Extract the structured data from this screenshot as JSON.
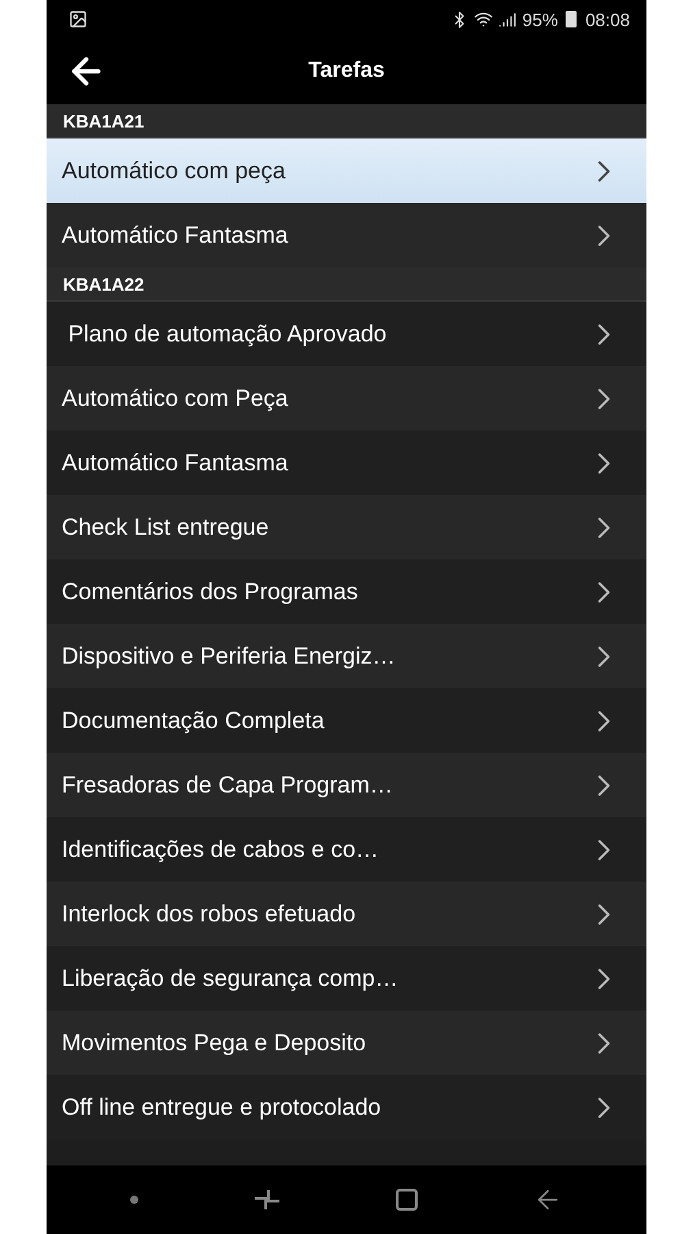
{
  "status_bar": {
    "battery": "95%",
    "time": "08:08"
  },
  "header": {
    "title": "Tarefas"
  },
  "sections": [
    {
      "title": "KBA1A21",
      "items": [
        {
          "label": "Automático com peça",
          "selected": true
        },
        {
          "label": "Automático Fantasma",
          "selected": false
        }
      ]
    },
    {
      "title": "KBA1A22",
      "items": [
        {
          "label": " Plano de automação Aprovado",
          "selected": false
        },
        {
          "label": "Automático com Peça",
          "selected": false
        },
        {
          "label": "Automático Fantasma",
          "selected": false
        },
        {
          "label": "Check List entregue",
          "selected": false
        },
        {
          "label": "Comentários dos Programas",
          "selected": false
        },
        {
          "label": "Dispositivo e Periferia Energiz…",
          "selected": false
        },
        {
          "label": "Documentação Completa",
          "selected": false
        },
        {
          "label": "Fresadoras de Capa Program…",
          "selected": false
        },
        {
          "label": "Identificações de cabos e co…",
          "selected": false
        },
        {
          "label": "Interlock dos robos efetuado",
          "selected": false
        },
        {
          "label": "Liberação de segurança comp…",
          "selected": false
        },
        {
          "label": "Movimentos Pega e Deposito",
          "selected": false
        },
        {
          "label": "Off line entregue e protocolado",
          "selected": false
        }
      ]
    }
  ]
}
